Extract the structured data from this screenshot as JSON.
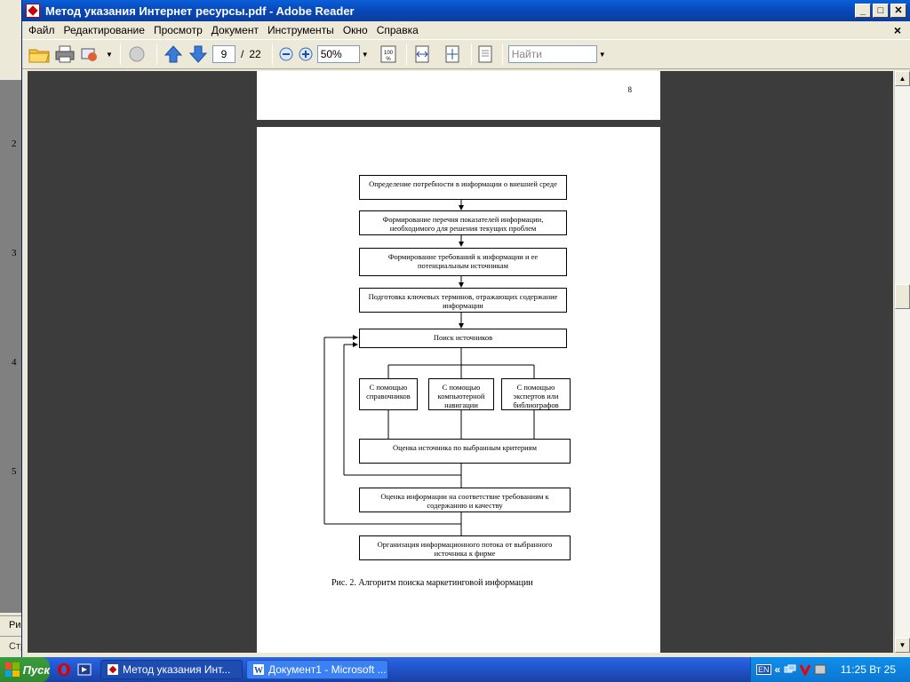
{
  "window": {
    "title": "Метод указания Интернет ресурсы.pdf - Adobe Reader"
  },
  "menu": [
    "Файл",
    "Редактирование",
    "Просмотр",
    "Документ",
    "Инструменты",
    "Окно",
    "Справка"
  ],
  "toolbar": {
    "current_page": "9",
    "page_sep": "/",
    "total_pages": "22",
    "zoom": "50%",
    "find_placeholder": "Найти"
  },
  "document": {
    "page_number": "8",
    "flowchart": {
      "step1": "Определение потребности в информации о внешней среде",
      "step2": "Формирование перечня показателей информации, необходимого для решения текущих проблем",
      "step3": "Формирование требований к информации и ее потенциальным источникам",
      "step4": "Подготовка ключевых терминов, отражающих содержание информации",
      "step5": "Поиск источников",
      "branch1": "С помощью справочников",
      "branch2": "С помощью компьютерной навигации",
      "branch3": "С помощью экспертов или библиографов",
      "step6": "Оценка источника по выбранным критериям",
      "step7": "Оценка информации на соответствие требованиям к содержанию и качеству",
      "step8": "Организация информационного потока от выбранного источника к фирме"
    },
    "caption": "Рис. 2. Алгоритм поиска маркетинговой информации"
  },
  "background_window": {
    "ruler_numbers": [
      "2",
      "3",
      "4",
      "5"
    ],
    "bottom_label_a": "Ри",
    "bottom_label_b": "Стр"
  },
  "taskbar": {
    "start_label": "Пуск",
    "tasks": [
      "Метод указания Инт...",
      "Документ1 - Microsoft ..."
    ],
    "lang": "EN",
    "tray_arrow": "«",
    "clock": "11:25 Вт 25"
  }
}
